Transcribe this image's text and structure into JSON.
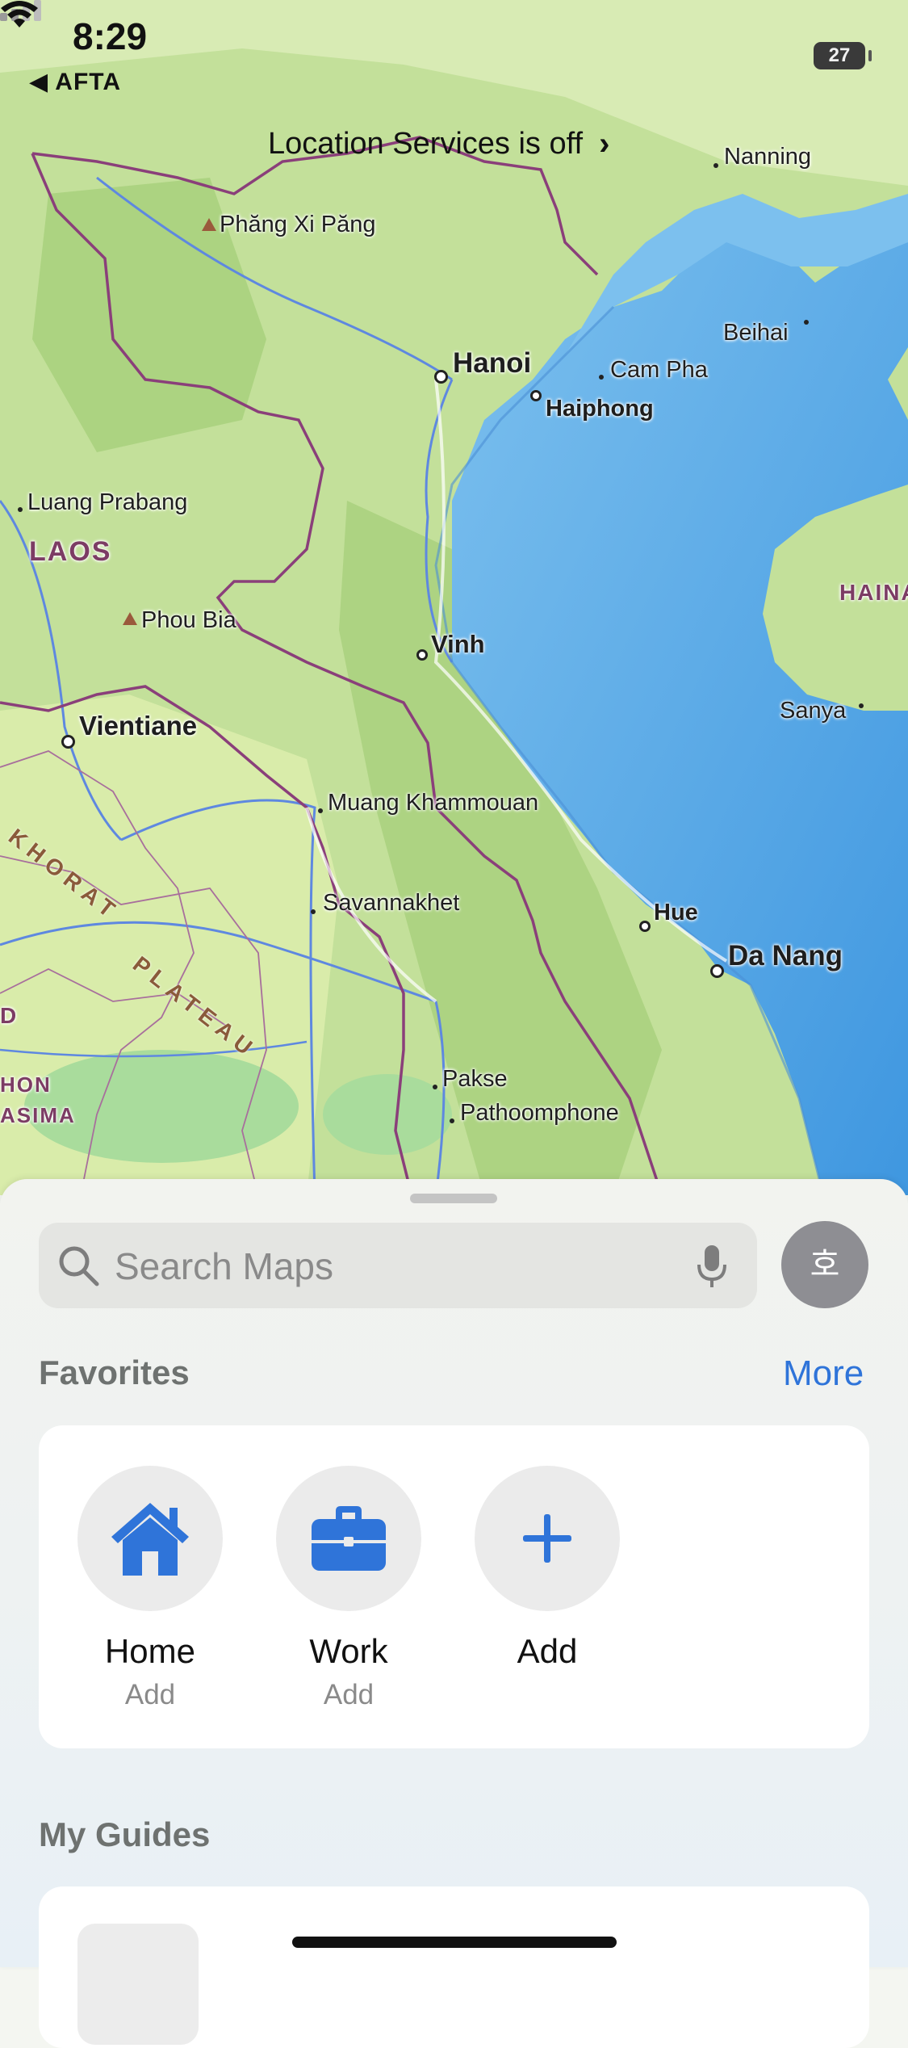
{
  "status_bar": {
    "time": "8:29",
    "back_app": "◀ AFTA",
    "battery": "27"
  },
  "location_banner": {
    "text": "Location Services is off",
    "chevron": "›"
  },
  "map": {
    "cities": {
      "nanning": "Nanning",
      "phang_xi_pang": "Phăng Xi Păng",
      "beihai": "Beihai",
      "hanoi": "Hanoi",
      "cam_pha": "Cam Pha",
      "haiphong": "Haiphong",
      "luang_prabang": "Luang Prabang",
      "laos": "LAOS",
      "hainan": "HAINA",
      "phou_bia": "Phou Bia",
      "vinh": "Vinh",
      "sanya": "Sanya",
      "vientiane": "Vientiane",
      "muang_khammouan": "Muang Khammouan",
      "savannakhet": "Savannakhet",
      "hue": "Hue",
      "da_nang": "Da Nang",
      "pakse": "Pakse",
      "pathoomphone": "Pathoomphone",
      "khon": "HON",
      "asima": "ASIMA",
      "d": "D",
      "khorat": "KHORAT",
      "plateau": "PLATEAU"
    }
  },
  "search": {
    "placeholder": "Search Maps",
    "avatar": "호"
  },
  "favorites": {
    "title": "Favorites",
    "more": "More",
    "items": [
      {
        "name": "Home",
        "sub": "Add",
        "icon": "house-icon"
      },
      {
        "name": "Work",
        "sub": "Add",
        "icon": "briefcase-icon"
      },
      {
        "name": "Add",
        "sub": "",
        "icon": "plus-icon"
      }
    ]
  },
  "guides": {
    "title": "My Guides"
  },
  "colors": {
    "accent": "#2f74d9",
    "water": "#5aa8e6",
    "land": "#b9dc8e",
    "border": "#8a3f7a"
  }
}
